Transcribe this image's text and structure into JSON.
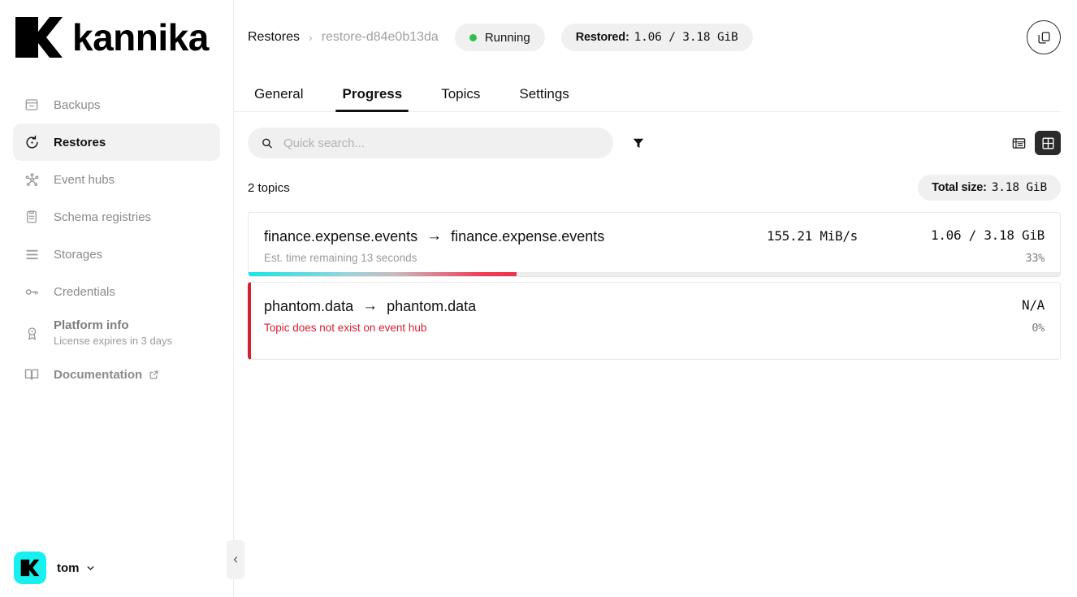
{
  "brand": {
    "name": "kannika"
  },
  "sidebar": {
    "items": [
      {
        "label": "Backups",
        "icon": "archive-box-icon",
        "active": false
      },
      {
        "label": "Restores",
        "icon": "restore-clock-icon",
        "active": true
      },
      {
        "label": "Event hubs",
        "icon": "nodes-network-icon",
        "active": false
      },
      {
        "label": "Schema registries",
        "icon": "clipboard-list-icon",
        "active": false
      },
      {
        "label": "Storages",
        "icon": "server-stack-icon",
        "active": false
      },
      {
        "label": "Credentials",
        "icon": "key-icon",
        "active": false
      }
    ],
    "platform_info": {
      "label": "Platform info",
      "sublabel": "License expires in 3 days",
      "icon": "badge-seal-icon"
    },
    "documentation": {
      "label": "Documentation",
      "icon": "book-open-icon",
      "external_icon": "external-link-icon"
    },
    "user": {
      "name": "tom",
      "avatar_icon": "kannika-k-avatar",
      "caret_icon": "chevron-down-icon"
    },
    "collapse": {
      "icon": "chevron-left-icon"
    }
  },
  "header": {
    "breadcrumb_root": "Restores",
    "breadcrumb_sep": "›",
    "breadcrumb_current": "restore-d84e0b13da",
    "status": {
      "label": "Running",
      "dot_color": "#2fbf4f"
    },
    "restored": {
      "prefix": "Restored:",
      "value": "1.06 / 3.18 GiB"
    },
    "action_icon": "duplicate-copy-icon"
  },
  "tabs": [
    {
      "label": "General",
      "active": false
    },
    {
      "label": "Progress",
      "active": true
    },
    {
      "label": "Topics",
      "active": false
    },
    {
      "label": "Settings",
      "active": false
    }
  ],
  "toolbar": {
    "search_placeholder": "Quick search...",
    "search_value": "",
    "search_icon": "search-icon",
    "filter_icon": "filter-funnel-icon",
    "list_view_icon": "list-view-icon",
    "grid_view_icon": "grid-view-icon",
    "active_view": "grid"
  },
  "summary": {
    "topic_count_label": "2 topics",
    "total_size_prefix": "Total size:",
    "total_size_value": "3.18 GiB"
  },
  "topics": [
    {
      "source": "finance.expense.events",
      "arrow": "→",
      "target": "finance.expense.events",
      "subtitle": "Est. time remaining 13 seconds",
      "rate": "155.21 MiB/s",
      "bytes": "1.06 / 3.18 GiB",
      "percent_label": "33%",
      "percent": 33,
      "state": "running"
    },
    {
      "source": "phantom.data",
      "arrow": "→",
      "target": "phantom.data",
      "subtitle": "Topic does not exist on event hub",
      "rate": "",
      "bytes": "N/A",
      "percent_label": "0%",
      "percent": 0,
      "state": "error"
    }
  ],
  "colors": {
    "accent_cyan": "#18e6e6",
    "error_red": "#d62030",
    "progress_end": "#f0334f",
    "status_green": "#2fbf4f",
    "active_dark": "#2b2b2b"
  }
}
